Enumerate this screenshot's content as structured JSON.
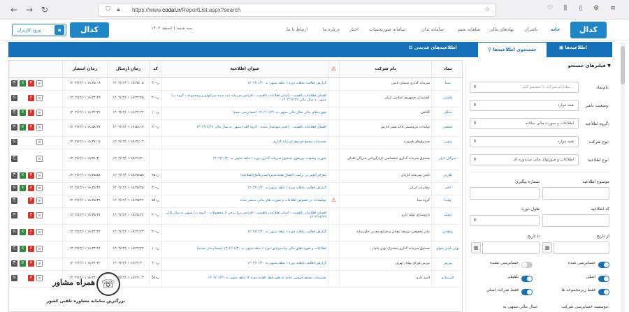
{
  "browser": {
    "url_prefix": "https://www.",
    "url_domain": "codal.ir",
    "url_path": "/ReportList.aspx?search"
  },
  "header": {
    "logo": "کدال",
    "logo_secondary": "کدال",
    "login_label": "ورود کاربران",
    "date": "سه شنبه ۱ اسفند ۱۴۰۲",
    "menu": [
      "خانه",
      "ناشران",
      "نهادهای مالی",
      "سامانه ستم",
      "سامانه ثدان",
      "سامانه صورتحساب",
      "اخبار",
      "درباره ما",
      "ارتباط با ما"
    ]
  },
  "tabs": {
    "active": "جستجوی اطلاعیه‌ها",
    "notices": "اطلاعیه‌ها",
    "old_notices": "اطلاعیه‌های قدیمی"
  },
  "filters": {
    "title": "فیلترهای جستجو",
    "symbol_label": "نام‌نماد:",
    "symbol_placeholder": "نماد/نام شرکت یا جستجو کنید...",
    "status_label": "وضعیت ناشر:",
    "status_value": "همه موارد",
    "group_label": "گروه اطلاعیه:",
    "group_value": "اطلاعات و صورت مالی سالانه",
    "company_type_label": "نوع شرکت:",
    "company_type_value": "همه موارد",
    "notice_type_label": "نوع اطلاعیه:",
    "notice_type_value": "اطلاعات و صورتهای مالی میاندوره ای",
    "subject_label": "موضوع اطلاعیه",
    "tracking_label": "شماره پیگیری",
    "code_label": "کد اطلاعیه",
    "period_label": "طول دوره",
    "from_date_label": "از تاریخ",
    "to_date_label": "تا تاریخ",
    "toggles": [
      {
        "label": "حسابرسی شده",
        "on": true
      },
      {
        "label": "حسابرسی نشده",
        "on": false
      },
      {
        "label": "اصلی",
        "on": true
      },
      {
        "label": "تلفیقی",
        "on": true
      },
      {
        "label": "فقط زیرمجموعه ها",
        "on": true
      },
      {
        "label": "فقط شرکت اصلی",
        "on": true
      }
    ],
    "footer_left": "سال مالی منتهی به:",
    "footer_right": "موسسه حسابرسی شرکت:"
  },
  "table": {
    "headers": {
      "symbol": "نماد",
      "company": "نام شرکت",
      "title": "عنوان اطلاعیه",
      "code": "کد",
      "sent": "زمان ارسال",
      "published": "زمان انتشار"
    },
    "rows": [
      {
        "symbol": "سیتا",
        "company": "سرمایه گذاری سیمان تامین",
        "title": "گزارش فعالیت ماهانه دوره ۱ ماهه منتهی به ۱۴۰۲/۱۱/۳۰",
        "code": "ن-۳۰",
        "sent": "۱۴۰۲/۱۲/۰۱ ۱۸:۴۵:۰۵",
        "published": "۱۴۰۲/۱۲/۰۱ ۱۸:۴۵:۰۸",
        "warn": false,
        "icons": [
          "doc",
          "pdf",
          "xls",
          "att"
        ]
      },
      {
        "symbol": "تکشتی",
        "company": "کشتیرانی جمهوری اسلامی ایران",
        "title": "افشای اطلاعات بااهمیت - (سایر اطلاعات بااهمیت - افزایش سرمایه ثبت شده شرکتهای زیرمجموعه - گروه ب) منتهی به سال مالی ۱۴۰۲/۱۲/۲۹",
        "code": "ن-۳۰",
        "sent": "۱۴۰۲/۱۲/۰۱ ۱۸:۳۴:۲۵",
        "published": "۱۴۰۲/۱۲/۰۱ ۱۸:۳۴:۲۹",
        "warn": false,
        "icons": [
          "doc",
          "pdf",
          "att"
        ]
      },
      {
        "symbol": "شگل",
        "company": "گلتاش",
        "title": "صورت‌های مالی سال مالی منتهی به ۱۴۰۲/۰۶/۳۱ (حسابرسی شده)",
        "code": "ن-۱۰",
        "sent": "۱۴۰۲/۱۲/۰۱ ۱۸:۲۲:۴۲",
        "published": "۱۴۰۲/۱۲/۰۱ ۱۸:۲۲:۴۹",
        "warn": false,
        "icons": [
          "doc",
          "pdf",
          "xls",
          "att"
        ]
      },
      {
        "symbol": "شبصیر",
        "company": "تولیدات پتروشیمی قائد بصیر فارس",
        "title": "افشای اطلاعات بااهمیت - (تغییر سهامدار عمده - گروه الف) منتهی به سال مالی ۱۴۰۲/۱۲/۲۹",
        "code": "ن-۳۰",
        "sent": "۱۴۰۲/۱۲/۰۱ ۱۸:۵۸:۱۷",
        "published": "۱۴۰۲/۱۲/۰۱ ۱۸:۵۸:۲۷",
        "warn": false,
        "icons": [
          "doc",
          "pdf",
          "xls",
          "att"
        ]
      },
      {
        "symbol": "ونوین",
        "company": "صندوق‌های فیروزه",
        "title": "تصمیمات مجمع صندوق سرمایه گذاری",
        "code": "",
        "sent": "۱۴۰۲/۱۲/۰۱ ۱۸:۳۷:۰۴",
        "published": "۱۴۰۲/۱۲/۰۱ ۱۸:۳۷:۰۵",
        "warn": false,
        "icons": [
          "doc",
          "att"
        ]
      },
      {
        "symbol": "خبرگان بازار",
        "company": "صندوق سرمایه گذاری اختصاصی بازارگردانی خبرگان اهداف",
        "title": "صورت وضعیت پورتفوی صندوق سرمایه گذاری دوره ۱ ماهه منتهی به ۱۴۰۲/۱۱/۳۰",
        "code": "",
        "sent": "۱۴۰۲/۱۲/۰۱ ۱۸:۲۶:۳۰",
        "published": "۱۴۰۲/۱۲/۰۱ ۱۸:۲۶:۳۰",
        "warn": false,
        "icons": [
          "doc",
          "att"
        ]
      },
      {
        "symbol": "تکارتی",
        "company": "تأمین سرمایه کاردان",
        "title": "معرفی/تغییر در ترکیب اعضای هیئت‌مدیره/مدیرعامل(اصلاحیه)",
        "code": "ن-۴۵",
        "sent": "۱۴۰۲/۱۲/۰۱ ۱۸:۲۵:۵۸",
        "published": "۱۴۰۲/۱۲/۰۱ ۱۸:۲۵:۵۸",
        "warn": false,
        "icons": [
          "doc",
          "pdf",
          "xls",
          "att"
        ]
      },
      {
        "symbol": "اختر",
        "company": "مخابرات ایران",
        "title": "گزارش فعالیت ماهانه دوره ۱ ماهه منتهی به ۱۴۰۲/۱۱/۳۰",
        "code": "ن-۳۰",
        "sent": "۱۴۰۲/۱۲/۰۱ ۱۸:۲۵:۳۵",
        "published": "۱۴۰۲/۱۲/۰۱ ۱۸:۲۵:۳۹",
        "warn": false,
        "icons": [
          "doc",
          "pdf",
          "xls",
          "att"
        ]
      },
      {
        "symbol": "ومینا",
        "company": "گروه مینا",
        "title": "توضیحات در خصوص اطلاعات و صورت های مالی منتشر شده",
        "code": "ن-۵۸",
        "sent": "۱۴۰۲/۱۲/۰۱ ۱۸:۲۵:۳۲",
        "published": "۱۴۰۲/۱۲/۰۱ ۱۸:۲۵:۳۹",
        "warn": true,
        "icons": [
          "doc",
          "pdf",
          "att"
        ]
      },
      {
        "symbol": "دتولید",
        "company": "داروسازی تولید دارو",
        "title": "افشای اطلاعات بااهمیت - (سایر اطلاعات بااهمیت - افزایش نرخ برخی از محصولات - گروه ب) منتهی به سال مالی ۱۴۰۲/۱۲/۲۹",
        "code": "ن-۳۰",
        "sent": "۱۴۰۲/۱۲/۰۱ ۱۸:۲۵:۲۲",
        "published": "۱۴۰۲/۱۲/۰۱ ۱۸:۲۵:۲۷",
        "warn": false,
        "icons": [
          "doc",
          "pdf",
          "att"
        ]
      },
      {
        "symbol": "ومعادن",
        "company": "مادر تخصصی توسعه معادن و صنایع معدنی خاورمیانه",
        "title": "گزارش فعالیت ماهانه دوره ۱ ماهه منتهی به ۱۴۰۲/۱۱/۳۰",
        "code": "ن-۳۰",
        "sent": "۱۴۰۲/۱۲/۰۱ ۱۸:۲۴:۴۳",
        "published": "۱۴۰۲/۱۲/۰۱ ۱۸:۲۴:۴۳",
        "warn": false,
        "icons": [
          "doc",
          "pdf",
          "xls",
          "att"
        ]
      },
      {
        "symbol": "نوین پایدار سهام",
        "company": "صندوق سرمایه گذاری مشترک نوین پایدار",
        "title": "اطلاعات و صورت‌های مالی میاندوره‌ای دوره ۶ ماهه منتهی به ۱۴۰۲/۱۱/۳۰ (حسابرسی نشده)",
        "code": "ن-۱۰",
        "sent": "۱۴۰۲/۱۲/۰۱ ۱۸:۲۴:۲۲",
        "published": "۱۴۰۲/۱۲/۰۱ ۱۸:۲۴:۲۶",
        "warn": false,
        "icons": [
          "doc",
          "pdf",
          "xls",
          "att"
        ]
      },
      {
        "symbol": "بورس",
        "company": "بورس اوراق بهادار تهران",
        "title": "گزارش فعالیت ماهانه دوره ۱ ماهه منتهی به ۱۴۰۲/۱۱/۳۰",
        "code": "ن-۳۰",
        "sent": "۱۴۰۲/۱۲/۰۱ ۱۸:۲۴:۲۰",
        "published": "۱۴۰۲/۱۲/۰۱ ۱۸:۲۴:۲۲",
        "warn": false,
        "icons": [
          "doc",
          "pdf",
          "xls",
          "att"
        ]
      },
      {
        "symbol": "البرزدارو",
        "company": "البرز دارو",
        "title": "تصمیمات مجمع عمومی عادی به طور فوق العاده دوره ۱۲ ماهه منتهی به ۱۴۰۲/۰۶/۳۱",
        "code": "ن-۵۸",
        "sent": "۱۴۰۲/۱۲/۰۱ ۱۸:۲۴:۰۳",
        "published": "۱۴۰۲/۱۲/۰۱ ۱۸:۲۴:۰۵",
        "warn": false,
        "icons": [
          "doc",
          "pdf",
          "att"
        ]
      }
    ]
  },
  "watermark": {
    "title": "همراه مشاور",
    "subtitle": "بزرگترین سامانه مشاوره تلفنی کشور"
  }
}
